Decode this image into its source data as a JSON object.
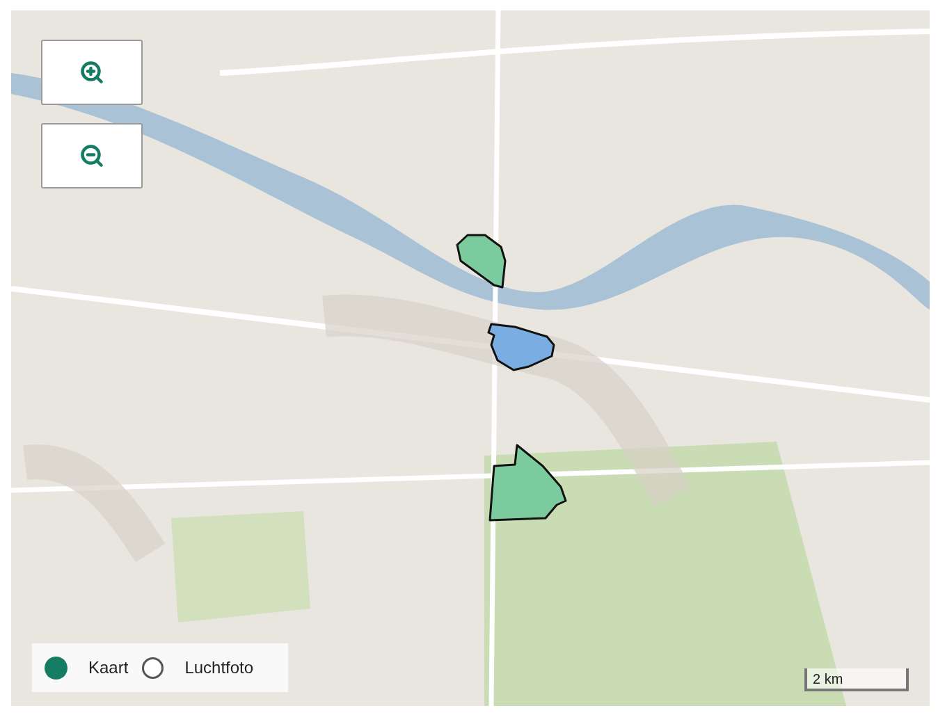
{
  "zoom_buttons": [
    {
      "kind": "in"
    },
    {
      "kind": "out"
    }
  ],
  "areas": [
    {
      "color": "#7ccb9e"
    },
    {
      "color": "#7aaee3"
    },
    {
      "color": "#7ccb9e"
    }
  ],
  "layer_switch": [
    {
      "label": "Kaart",
      "selected": true
    },
    {
      "label": "Luchtfoto",
      "selected": false
    }
  ],
  "scale_bar": {
    "label": "2 km"
  }
}
